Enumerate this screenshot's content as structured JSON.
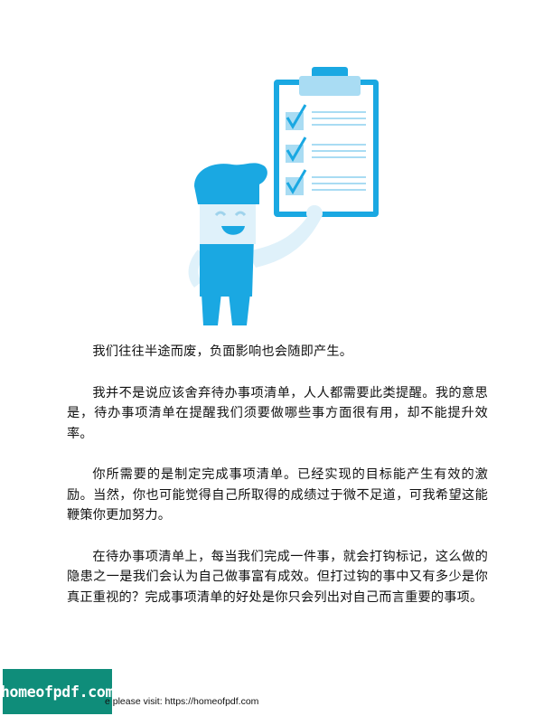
{
  "paragraphs": [
    "我们往往半途而废，负面影响也会随即产生。",
    "我并不是说应该舍弃待办事项清单，人人都需要此类提醒。我的意思是，待办事项清单在提醒我们须要做哪些事方面很有用，却不能提升效率。",
    "你所需要的是制定完成事项清单。已经实现的目标能产生有效的激励。当然，你也可能觉得自己所取得的成绩过于微不足道，可我希望这能鞭策你更加努力。",
    "在待办事项清单上，每当我们完成一件事，就会打钩标记，这么做的隐患之一是我们会认为自己做事富有成效。但打过钩的事中又有多少是你真正重视的？完成事项清单的好处是你只会列出对自己而言重要的事项。"
  ],
  "footer": {
    "logo_text": "homeofpdf.com",
    "note": "e please visit: https://homeofpdf.com"
  },
  "colors": {
    "illustration_blue": "#1aa8e2",
    "illustration_light": "#a9dcf3",
    "illustration_pale": "#dff1fa",
    "logo_bg": "#0f8d7a"
  },
  "icons": {
    "illustration": "person-holding-checklist-clipboard"
  }
}
